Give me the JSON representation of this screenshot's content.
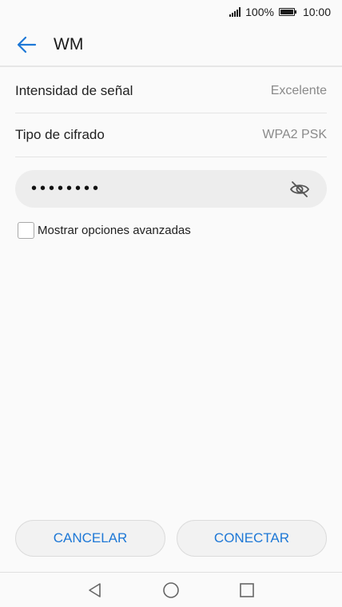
{
  "status_bar": {
    "battery_percent": "100%",
    "time": "10:00"
  },
  "app_bar": {
    "title": "WM",
    "back_icon": "arrow-left-icon"
  },
  "details": [
    {
      "label": "Intensidad de señal",
      "value": "Excelente"
    },
    {
      "label": "Tipo de cifrado",
      "value": "WPA2 PSK"
    }
  ],
  "password": {
    "masked_value": "••••••••",
    "toggle_icon": "eye-off-icon"
  },
  "advanced_options": {
    "label": "Mostrar opciones avanzadas",
    "checked": false
  },
  "buttons": {
    "cancel": "CANCELAR",
    "connect": "CONECTAR"
  },
  "colors": {
    "accent": "#1e78d6",
    "background": "#fafafa"
  }
}
